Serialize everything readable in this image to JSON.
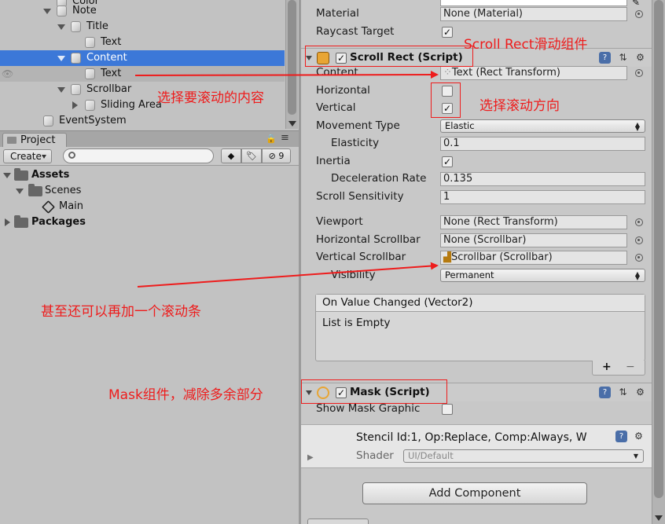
{
  "hierarchy": {
    "items": [
      {
        "label": "Color"
      },
      {
        "label": "Note"
      },
      {
        "label": "Title"
      },
      {
        "label": "Text"
      },
      {
        "label": "Content"
      },
      {
        "label": "Text"
      },
      {
        "label": "Scrollbar"
      },
      {
        "label": "Sliding Area"
      },
      {
        "label": "EventSystem"
      }
    ]
  },
  "project": {
    "tab_label": "Project",
    "create_label": "Create",
    "search_placeholder": "",
    "hidden_count": "9",
    "tree": [
      {
        "label": "Assets"
      },
      {
        "label": "Scenes"
      },
      {
        "label": "Main"
      },
      {
        "label": "Packages"
      }
    ]
  },
  "inspector": {
    "material_label": "Material",
    "material_value": "None (Material)",
    "raycast_label": "Raycast Target",
    "scroll_rect": {
      "title": "Scroll Rect (Script)",
      "content_label": "Content",
      "content_value": "Text (Rect Transform)",
      "horizontal_label": "Horizontal",
      "vertical_label": "Vertical",
      "movement_type_label": "Movement Type",
      "movement_type_value": "Elastic",
      "elasticity_label": "Elasticity",
      "elasticity_value": "0.1",
      "inertia_label": "Inertia",
      "deceleration_label": "Deceleration Rate",
      "deceleration_value": "0.135",
      "sensitivity_label": "Scroll Sensitivity",
      "sensitivity_value": "1",
      "viewport_label": "Viewport",
      "viewport_value": "None (Rect Transform)",
      "hscrollbar_label": "Horizontal Scrollbar",
      "hscrollbar_value": "None (Scrollbar)",
      "vscrollbar_label": "Vertical Scrollbar",
      "vscrollbar_value": "Scrollbar (Scrollbar)",
      "visibility_label": "Visibility",
      "visibility_value": "Permanent",
      "event_title": "On Value Changed (Vector2)",
      "event_body": "List is Empty",
      "plus": "+",
      "minus": "−"
    },
    "mask": {
      "title": "Mask (Script)",
      "show_graphic_label": "Show Mask Graphic"
    },
    "stencil_text": "Stencil Id:1, Op:Replace, Comp:Always, W",
    "shader_label": "Shader",
    "shader_value": "UI/Default",
    "add_component": "Add Component"
  },
  "annotations": {
    "scroll_rect": "Scroll Rect滑动组件",
    "content": "选择要滚动的内容",
    "direction": "选择滚动方向",
    "scrollbar": "甚至还可以再加一个滚动条",
    "mask": "Mask组件，减除多余部分"
  },
  "colors": {
    "annotation": "#ee1c1c",
    "selection": "#3c78d8",
    "panel_bg": "#c2c2c2",
    "inspector_bg": "#c8c8c8"
  }
}
